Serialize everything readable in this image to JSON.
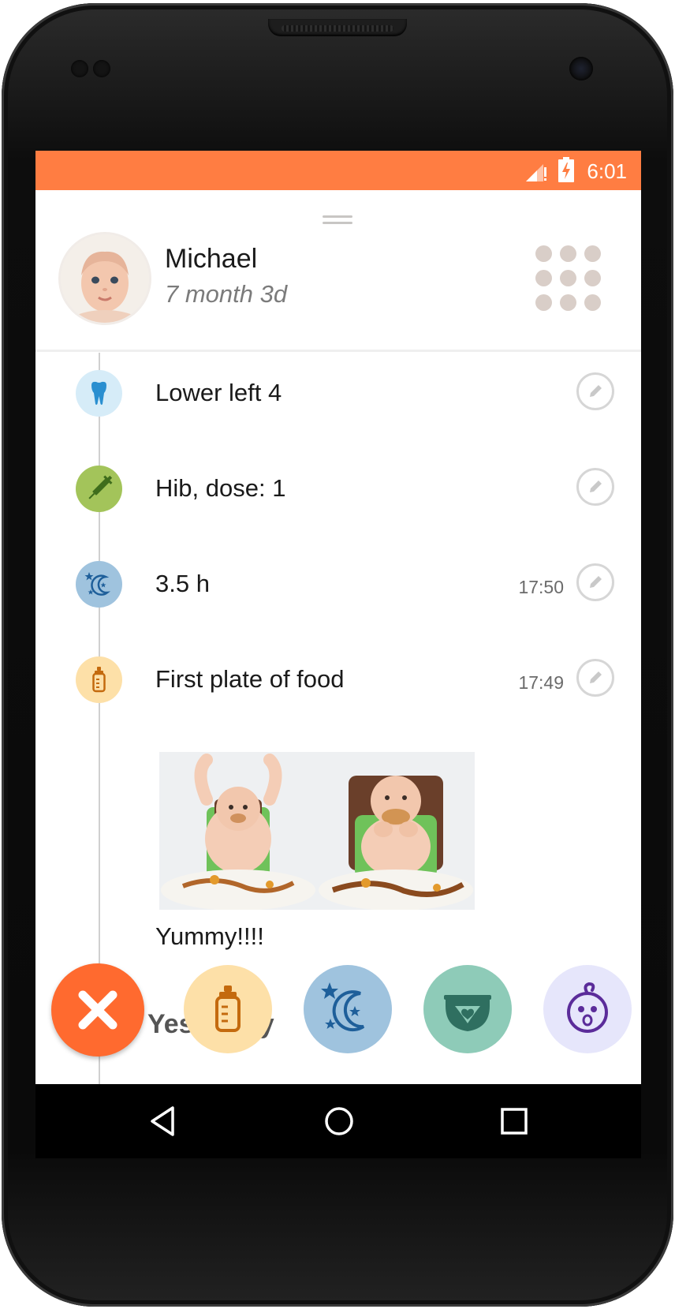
{
  "status_bar": {
    "time": "6:01",
    "icons": [
      "signal-icon",
      "battery-charging-icon"
    ],
    "color": "#ff7d42"
  },
  "profile": {
    "name": "Michael",
    "age": "7 month 3d",
    "avatar": "baby-avatar",
    "menu_icon": "grid-menu-icon"
  },
  "timeline": {
    "entries": [
      {
        "icon": "tooth-icon",
        "icon_color": "#d6ecf8",
        "label": "Lower left 4",
        "time": ""
      },
      {
        "icon": "syringe-icon",
        "icon_color": "#a3c45a",
        "label": "Hib, dose: 1",
        "time": ""
      },
      {
        "icon": "sleep-moon-icon",
        "icon_color": "#9fc3de",
        "label": "3.5 h",
        "time": "17:50"
      },
      {
        "icon": "bottle-icon",
        "icon_color": "#fde0a8",
        "label": "First plate of food",
        "time": "17:49"
      }
    ],
    "photos": [
      "baby-eating-photo-1",
      "baby-eating-photo-2"
    ],
    "note": "Yummy!!!!",
    "section_heading": "Yesterday"
  },
  "action_menu": {
    "items": [
      {
        "name": "close",
        "color": "#ff6a2f"
      },
      {
        "name": "feeding",
        "color": "#fde0a8"
      },
      {
        "name": "sleep",
        "color": "#9fc3de"
      },
      {
        "name": "diaper",
        "color": "#8ecbb8"
      },
      {
        "name": "baby-mood",
        "color": "#e6e6fb"
      }
    ]
  },
  "nav_bar": {
    "buttons": [
      "back-icon",
      "home-icon",
      "recents-icon"
    ]
  }
}
